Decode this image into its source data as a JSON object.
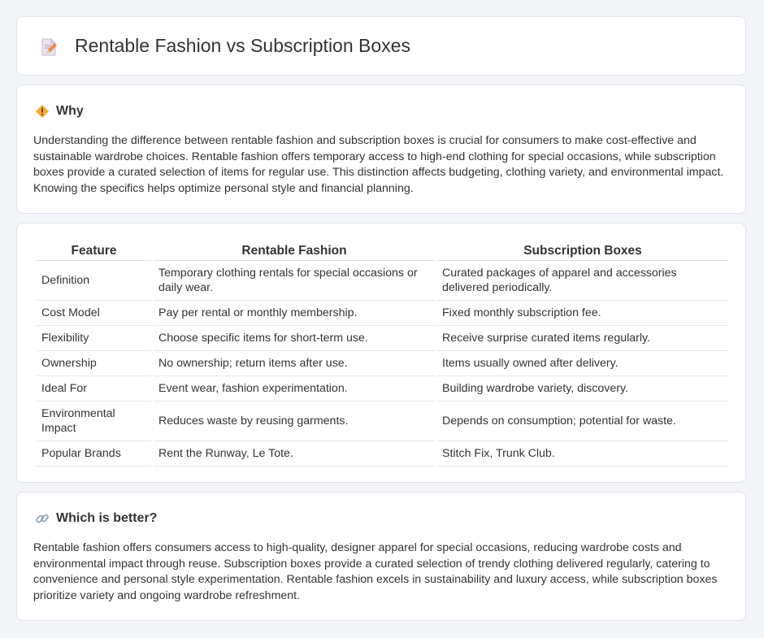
{
  "header": {
    "title": "Rentable Fashion vs Subscription Boxes",
    "icon": "document-edit-icon"
  },
  "why": {
    "heading": "Why",
    "icon": "warning-diamond-icon",
    "text": "Understanding the difference between rentable fashion and subscription boxes is crucial for consumers to make cost-effective and sustainable wardrobe choices. Rentable fashion offers temporary access to high-end clothing for special occasions, while subscription boxes provide a curated selection of items for regular use. This distinction affects budgeting, clothing variety, and environmental impact. Knowing the specifics helps optimize personal style and financial planning."
  },
  "table": {
    "headers": [
      "Feature",
      "Rentable Fashion",
      "Subscription Boxes"
    ],
    "rows": [
      [
        "Definition",
        "Temporary clothing rentals for special occasions or daily wear.",
        "Curated packages of apparel and accessories delivered periodically."
      ],
      [
        "Cost Model",
        "Pay per rental or monthly membership.",
        "Fixed monthly subscription fee."
      ],
      [
        "Flexibility",
        "Choose specific items for short-term use.",
        "Receive surprise curated items regularly."
      ],
      [
        "Ownership",
        "No ownership; return items after use.",
        "Items usually owned after delivery."
      ],
      [
        "Ideal For",
        "Event wear, fashion experimentation.",
        "Building wardrobe variety, discovery."
      ],
      [
        "Environmental Impact",
        "Reduces waste by reusing garments.",
        "Depends on consumption; potential for waste."
      ],
      [
        "Popular Brands",
        "Rent the Runway, Le Tote.",
        "Stitch Fix, Trunk Club."
      ]
    ]
  },
  "better": {
    "heading": "Which is better?",
    "icon": "link-icon",
    "text": "Rentable fashion offers consumers access to high-quality, designer apparel for special occasions, reducing wardrobe costs and environmental impact through reuse. Subscription boxes provide a curated selection of trendy clothing delivered regularly, catering to convenience and personal style experimentation. Rentable fashion excels in sustainability and luxury access, while subscription boxes prioritize variety and ongoing wardrobe refreshment."
  }
}
